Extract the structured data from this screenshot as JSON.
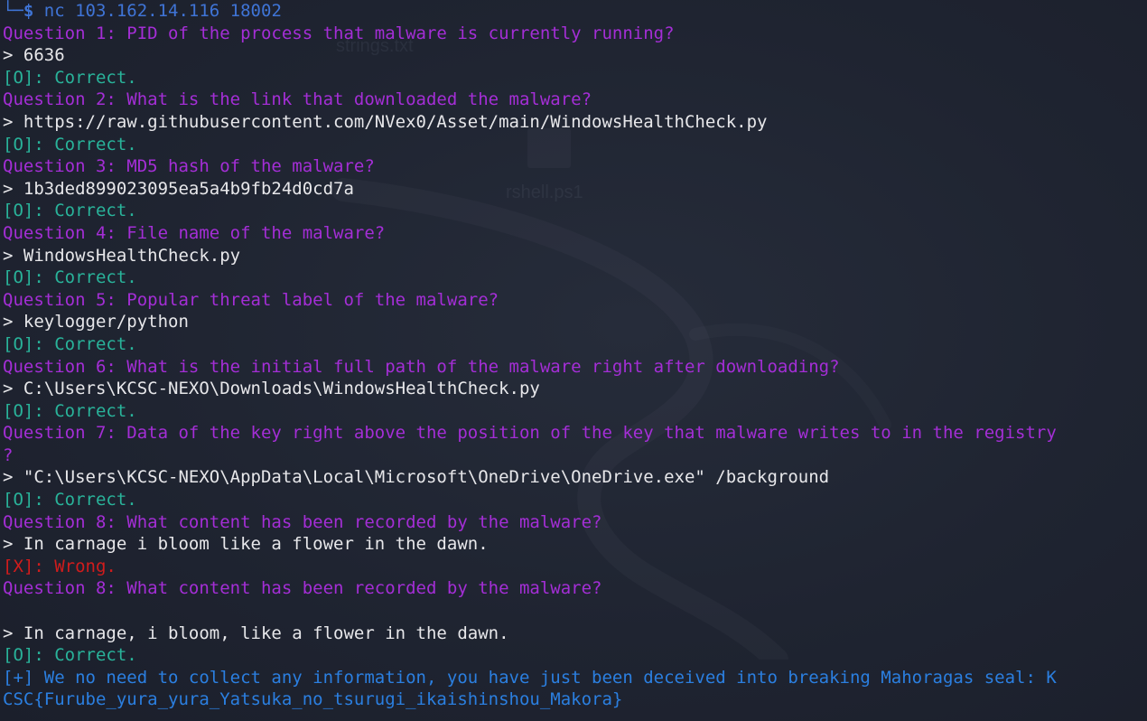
{
  "prompt": {
    "corner": "└─",
    "dollar": "$",
    "command": " nc 103.162.14.116 18002"
  },
  "wallpaper": {
    "file1": "strings.txt",
    "file2": "rshell.ps1"
  },
  "transcript": [
    {
      "kind": "question",
      "text": "Question 1: PID of the process that malware is currently running?"
    },
    {
      "kind": "answer",
      "text": "> 6636"
    },
    {
      "kind": "correct",
      "text": "[O]: Correct."
    },
    {
      "kind": "question",
      "text": "Question 2: What is the link that downloaded the malware?"
    },
    {
      "kind": "answer",
      "text": "> https://raw.githubusercontent.com/NVex0/Asset/main/WindowsHealthCheck.py"
    },
    {
      "kind": "correct",
      "text": "[O]: Correct."
    },
    {
      "kind": "question",
      "text": "Question 3: MD5 hash of the malware?"
    },
    {
      "kind": "answer",
      "text": "> 1b3ded899023095ea5a4b9fb24d0cd7a"
    },
    {
      "kind": "correct",
      "text": "[O]: Correct."
    },
    {
      "kind": "question",
      "text": "Question 4: File name of the malware?"
    },
    {
      "kind": "answer",
      "text": "> WindowsHealthCheck.py"
    },
    {
      "kind": "correct",
      "text": "[O]: Correct."
    },
    {
      "kind": "question",
      "text": "Question 5: Popular threat label of the malware?"
    },
    {
      "kind": "answer",
      "text": "> keylogger/python"
    },
    {
      "kind": "correct",
      "text": "[O]: Correct."
    },
    {
      "kind": "question",
      "text": "Question 6: What is the initial full path of the malware right after downloading?"
    },
    {
      "kind": "answer",
      "text": "> C:\\Users\\KCSC-NEXO\\Downloads\\WindowsHealthCheck.py"
    },
    {
      "kind": "correct",
      "text": "[O]: Correct."
    },
    {
      "kind": "question",
      "text": "Question 7: Data of the key right above the position of the key that malware writes to in the registry"
    },
    {
      "kind": "question",
      "text": "?"
    },
    {
      "kind": "answer",
      "text": "> \"C:\\Users\\KCSC-NEXO\\AppData\\Local\\Microsoft\\OneDrive\\OneDrive.exe\" /background"
    },
    {
      "kind": "correct",
      "text": "[O]: Correct."
    },
    {
      "kind": "question",
      "text": "Question 8: What content has been recorded by the malware?"
    },
    {
      "kind": "answer",
      "text": "> In carnage i bloom like a flower in the dawn."
    },
    {
      "kind": "wrong",
      "text": "[X]: Wrong."
    },
    {
      "kind": "question",
      "text": "Question 8: What content has been recorded by the malware?"
    },
    {
      "kind": "blank",
      "text": ""
    },
    {
      "kind": "answer",
      "text": "> In carnage, i bloom, like a flower in the dawn."
    },
    {
      "kind": "correct",
      "text": "[O]: Correct."
    },
    {
      "kind": "flag",
      "text": "[+] We no need to collect any information, you have just been deceived into breaking Mahoragas seal: K"
    },
    {
      "kind": "flag",
      "text": "CSC{Furube_yura_yura_Yatsuka_no_tsurugi_ikaishinshou_Makora}"
    }
  ],
  "colors": {
    "background": "#1f2431",
    "prompt": "#3f74d6",
    "question": "#a42ed6",
    "answer": "#e7e7ea",
    "correct": "#29b39a",
    "wrong": "#d11c1c",
    "flag": "#2b7fe0"
  }
}
